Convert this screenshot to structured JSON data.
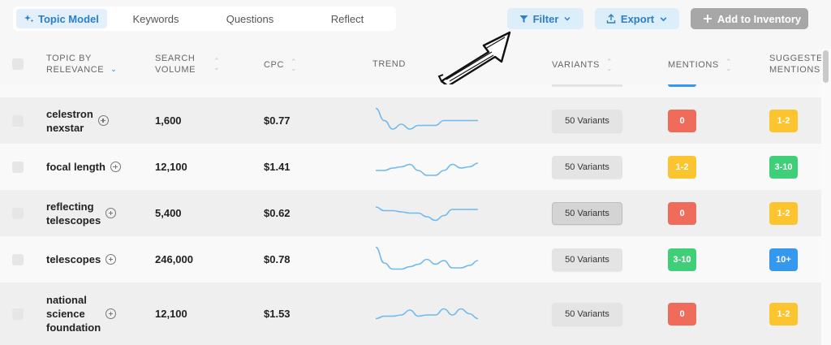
{
  "tabs": [
    "Topic Model",
    "Keywords",
    "Questions",
    "Reflect"
  ],
  "buttons": {
    "filter": "Filter",
    "export": "Export",
    "add": "Add to Inventory"
  },
  "columns": {
    "topic": [
      "TOPIC BY",
      "RELEVANCE"
    ],
    "volume": [
      "SEARCH",
      "VOLUME"
    ],
    "cpc": "CPC",
    "trend": "TREND",
    "variants": "VARIANTS",
    "mentions": "MENTIONS",
    "suggested": [
      "SUGGESTED",
      "MENTIONS"
    ]
  },
  "colors": {
    "red": "#ef6b5c",
    "yellow": "#fcc52f",
    "green": "#3fcf79",
    "blue": "#3498ef",
    "trend": "#6fb9ee"
  },
  "rows": [
    {
      "topic": [
        "celestron",
        "nexstar"
      ],
      "volume": "1,600",
      "cpc": "$0.77",
      "variants": "50 Variants",
      "mentions": "0",
      "mentions_color": "red",
      "suggested": "1-2",
      "suggested_color": "yellow",
      "trend": [
        0.05,
        0.55,
        0.9,
        0.7,
        0.9,
        0.75,
        0.75,
        0.75,
        0.55,
        0.55,
        0.55,
        0.55,
        0.55
      ]
    },
    {
      "topic": [
        "focal length"
      ],
      "volume": "12,100",
      "cpc": "$1.41",
      "variants": "50 Variants",
      "mentions": "1-2",
      "mentions_color": "yellow",
      "suggested": "3-10",
      "suggested_color": "green",
      "trend": [
        0.7,
        0.7,
        0.6,
        0.55,
        0.45,
        0.7,
        0.9,
        0.9,
        0.7,
        0.45,
        0.6,
        0.55,
        0.4
      ]
    },
    {
      "topic": [
        "reflecting",
        "telescopes"
      ],
      "volume": "5,400",
      "cpc": "$0.62",
      "variants": "50 Variants",
      "mentions": "0",
      "mentions_color": "red",
      "suggested": "1-2",
      "suggested_color": "yellow",
      "trend": [
        0.3,
        0.45,
        0.45,
        0.5,
        0.55,
        0.55,
        0.7,
        0.85,
        0.65,
        0.4,
        0.4,
        0.4,
        0.4
      ]
    },
    {
      "topic": [
        "telescopes"
      ],
      "volume": "246,000",
      "cpc": "$0.78",
      "variants": "50 Variants",
      "mentions": "3-10",
      "mentions_color": "green",
      "suggested": "10+",
      "suggested_color": "blue",
      "trend": [
        0.05,
        0.7,
        0.95,
        0.95,
        0.85,
        0.75,
        0.55,
        0.75,
        0.6,
        0.9,
        0.9,
        0.8,
        0.6
      ]
    },
    {
      "topic": [
        "national",
        "science",
        "foundation"
      ],
      "volume": "12,100",
      "cpc": "$1.53",
      "variants": "50 Variants",
      "mentions": "0",
      "mentions_color": "red",
      "suggested": "1-2",
      "suggested_color": "yellow",
      "trend": [
        0.75,
        0.65,
        0.65,
        0.6,
        0.4,
        0.65,
        0.6,
        0.6,
        0.35,
        0.6,
        0.35,
        0.55,
        0.75
      ]
    }
  ]
}
